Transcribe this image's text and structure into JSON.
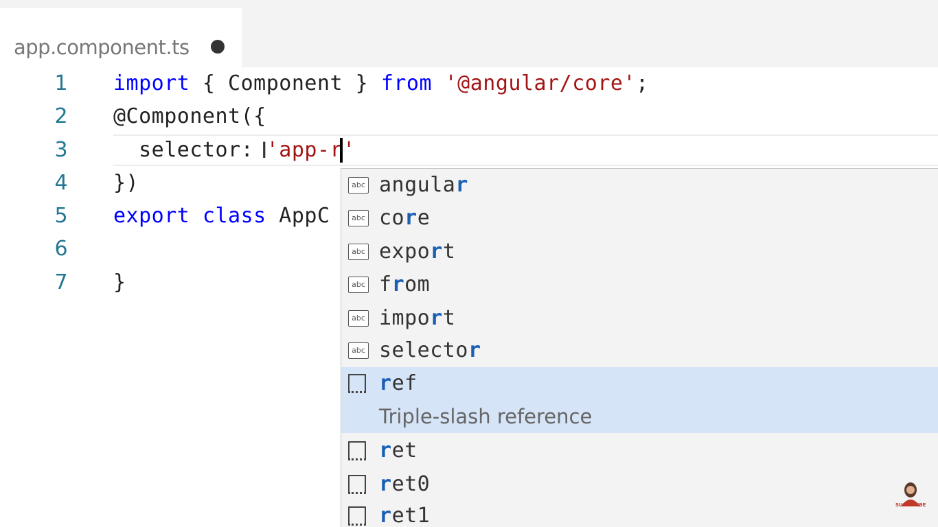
{
  "tab": {
    "title": "app.component.ts"
  },
  "code_lines": [
    {
      "number": "1",
      "tokens": [
        "import",
        " { Component } ",
        "from",
        " ",
        "'@angular/core'",
        ";"
      ]
    },
    {
      "number": "2",
      "text": "@Component({"
    },
    {
      "number": "3",
      "parts": [
        "  selector:",
        " ",
        "'app-r'"
      ]
    },
    {
      "number": "4",
      "text": "})"
    },
    {
      "number": "5",
      "tokens": [
        "export",
        " ",
        "class",
        " AppC"
      ]
    },
    {
      "number": "6",
      "text": ""
    },
    {
      "number": "7",
      "text": "}"
    }
  ],
  "suggestions": [
    {
      "icon": "abc",
      "pre": "angula",
      "match": "r",
      "post": ""
    },
    {
      "icon": "abc",
      "pre": "co",
      "match": "r",
      "post": "e"
    },
    {
      "icon": "abc",
      "pre": "expo",
      "match": "r",
      "post": "t"
    },
    {
      "icon": "abc",
      "pre": "f",
      "match": "r",
      "post": "om"
    },
    {
      "icon": "abc",
      "pre": "impo",
      "match": "r",
      "post": "t"
    },
    {
      "icon": "abc",
      "pre": "selecto",
      "match": "r",
      "post": ""
    },
    {
      "icon": "snippet",
      "pre": "",
      "match": "r",
      "post": "ef",
      "detail": "Triple-slash reference"
    },
    {
      "icon": "snippet",
      "pre": "",
      "match": "r",
      "post": "et"
    },
    {
      "icon": "snippet",
      "pre": "",
      "match": "r",
      "post": "et0"
    },
    {
      "icon": "snippet",
      "pre": "",
      "match": "r",
      "post": "et1"
    }
  ],
  "watermark": {
    "label": "SUBSCRIBE"
  },
  "colors": {
    "keyword": "#0000ff",
    "string": "#a31515",
    "line_number": "#237893",
    "match": "#1a5fb4",
    "selected_bg": "#d6e4f7"
  }
}
